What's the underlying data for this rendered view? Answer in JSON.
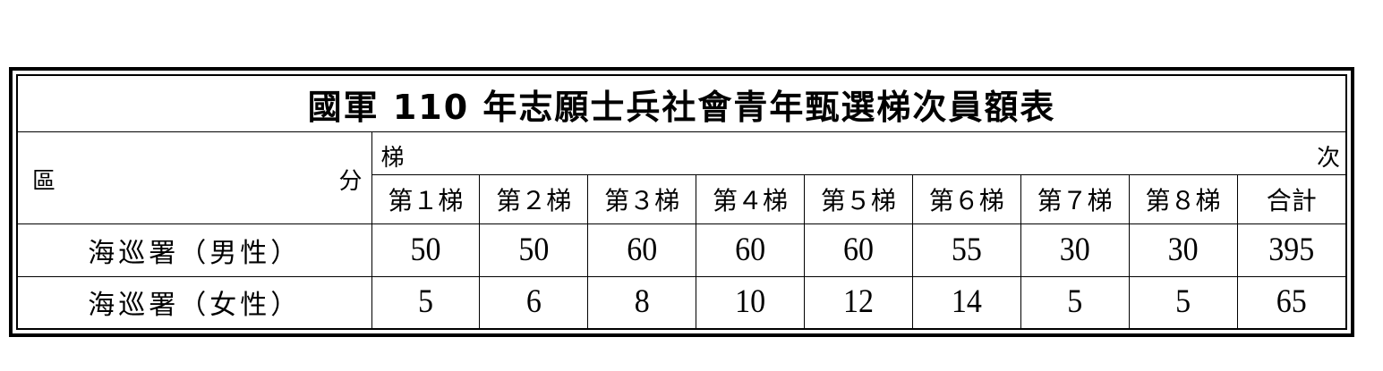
{
  "title": "國軍 110 年志願士兵社會青年甄選梯次員額表",
  "region_label": {
    "left": "區",
    "right": "分"
  },
  "group_label": {
    "left": "梯",
    "right": "次"
  },
  "columns": [
    "第１梯",
    "第２梯",
    "第３梯",
    "第４梯",
    "第５梯",
    "第６梯",
    "第７梯",
    "第８梯",
    "合計"
  ],
  "rows": [
    {
      "label": "海巡署（男性）",
      "values": [
        "50",
        "50",
        "60",
        "60",
        "60",
        "55",
        "30",
        "30",
        "395"
      ]
    },
    {
      "label": "海巡署（女性）",
      "values": [
        "5",
        "6",
        "8",
        "10",
        "12",
        "14",
        "5",
        "5",
        "65"
      ]
    }
  ]
}
